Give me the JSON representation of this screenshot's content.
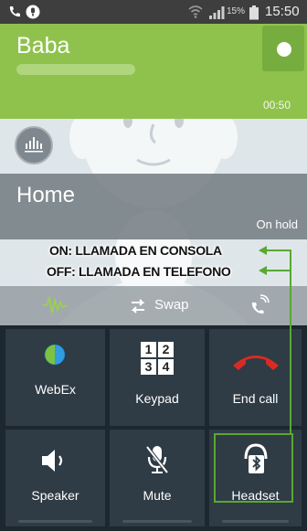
{
  "status_bar": {
    "battery_percent": "15%",
    "time": "15:50"
  },
  "active_call": {
    "name": "Baba",
    "timer": "00:50"
  },
  "held_call": {
    "name": "Home",
    "status": "On hold"
  },
  "annotations": {
    "on_text": "ON: LLAMADA EN CONSOLA",
    "off_text": "OFF: LLAMADA EN TELEFONO",
    "color": "#5aa832"
  },
  "action_strip": {
    "swap_label": "Swap"
  },
  "buttons": {
    "webex": "WebEx",
    "keypad": "Keypad",
    "keypad_digits": [
      "1",
      "2",
      "3",
      "4"
    ],
    "end_call": "End call",
    "speaker": "Speaker",
    "mute": "Mute",
    "headset": "Headset"
  },
  "colors": {
    "active_green": "#8fc24c",
    "end_call_red": "#d92b23",
    "grid_bg": "#1c2730",
    "button_bg": "#2f3b45"
  }
}
